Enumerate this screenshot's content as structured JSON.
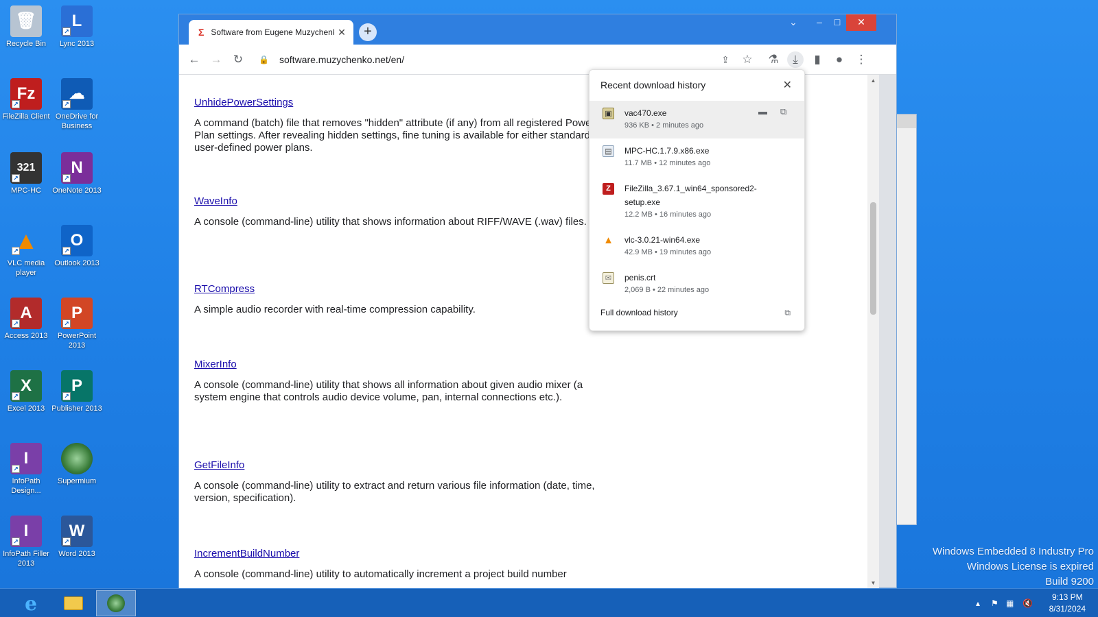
{
  "desktop": {
    "icons": [
      {
        "label": "Recycle Bin",
        "icon": "recycle-bin-icon",
        "color": "#b7c4d2"
      },
      {
        "label": "Lync 2013",
        "icon": "lync-icon",
        "color": "#2a6fd6"
      },
      {
        "label": "FileZilla Client",
        "icon": "filezilla-icon",
        "color": "#bf1e1e"
      },
      {
        "label": "OneDrive for Business",
        "icon": "onedrive-icon",
        "color": "#0f5bb5"
      },
      {
        "label": "MPC-HC",
        "icon": "mpc-hc-icon",
        "color": "#333333"
      },
      {
        "label": "OneNote 2013",
        "icon": "onenote-icon",
        "color": "#7b2e9a"
      },
      {
        "label": "VLC media player",
        "icon": "vlc-icon",
        "color": "#f08a00"
      },
      {
        "label": "Outlook 2013",
        "icon": "outlook-icon",
        "color": "#0f64c8"
      },
      {
        "label": "Access 2013",
        "icon": "access-icon",
        "color": "#b22b2b"
      },
      {
        "label": "PowerPoint 2013",
        "icon": "powerpoint-icon",
        "color": "#d24625"
      },
      {
        "label": "Excel 2013",
        "icon": "excel-icon",
        "color": "#1e7145"
      },
      {
        "label": "Publisher 2013",
        "icon": "publisher-icon",
        "color": "#077568"
      },
      {
        "label": "InfoPath Design...",
        "icon": "infopath-designer-icon",
        "color": "#7a3fa8"
      },
      {
        "label": "Supermium",
        "icon": "supermium-icon",
        "color": "#3a7d3a"
      },
      {
        "label": "InfoPath Filler 2013",
        "icon": "infopath-filler-icon",
        "color": "#7a3fa8"
      },
      {
        "label": "Word 2013",
        "icon": "word-icon",
        "color": "#2b579a"
      }
    ],
    "watermark": {
      "line1": "Windows Embedded 8 Industry Pro",
      "line2": "Windows License is expired",
      "line3": "Build 9200"
    }
  },
  "taskbar": {
    "time": "9:13 PM",
    "date": "8/31/2024"
  },
  "browser": {
    "tab_title": "Software from Eugene Muzychenko",
    "new_tab": "+",
    "url": "software.muzychenko.net/en/",
    "entries": [
      {
        "title": "UnhidePowerSettings",
        "desc": "A command (batch) file that removes \"hidden\" attribute (if any) from all registered Power Plan settings. After revealing hidden settings, fine tuning is available for either standard or user-defined power plans."
      },
      {
        "title": "WaveInfo",
        "desc": "A console (command-line) utility that shows information about RIFF/WAVE (.wav) files."
      },
      {
        "title": "RTCompress",
        "desc": "A simple audio recorder with real-time compression capability."
      },
      {
        "title": "MixerInfo",
        "desc": "A console (command-line) utility that shows all information about given audio mixer (a system engine that controls audio device volume, pan, internal connections etc.)."
      },
      {
        "title": "GetFileInfo",
        "desc": "A console (command-line) utility to extract and return various file information (date, time, version, specification)."
      },
      {
        "title": "IncrementBuildNumber",
        "desc": "A console (command-line) utility to automatically increment a project build number"
      }
    ]
  },
  "downloads": {
    "heading": "Recent download history",
    "items": [
      {
        "name": "vac470.exe",
        "meta": "936 KB • 2 minutes ago"
      },
      {
        "name": "MPC-HC.1.7.9.x86.exe",
        "meta": "11.7 MB • 12 minutes ago"
      },
      {
        "name": "FileZilla_3.67.1_win64_sponsored2-setup.exe",
        "meta": "12.2 MB • 16 minutes ago"
      },
      {
        "name": "vlc-3.0.21-win64.exe",
        "meta": "42.9 MB • 19 minutes ago"
      },
      {
        "name": "penis.crt",
        "meta": "2,069 B • 22 minutes ago"
      }
    ],
    "full_history": "Full download history"
  }
}
